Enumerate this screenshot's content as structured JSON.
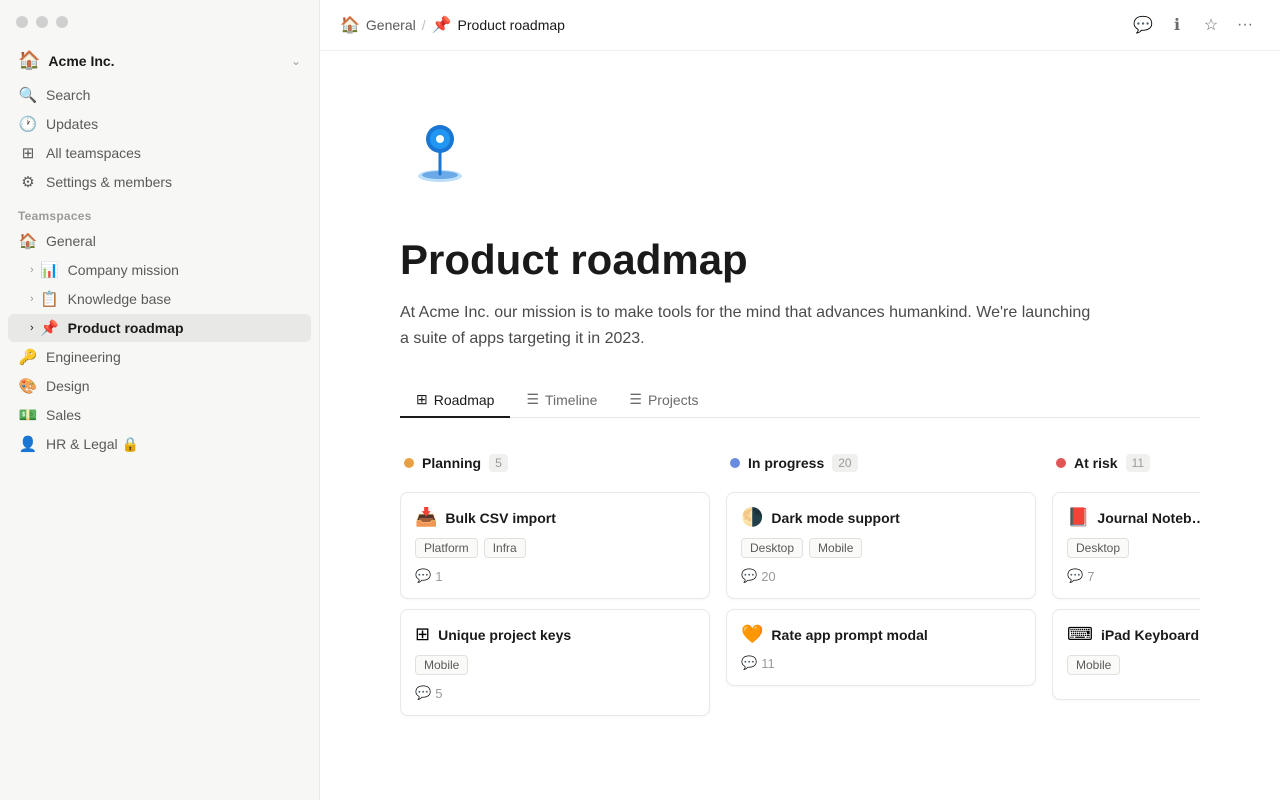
{
  "window": {
    "title": "Product roadmap"
  },
  "sidebar": {
    "workspace_name": "Acme Inc.",
    "workspace_chevron": "⌄",
    "nav_items": [
      {
        "id": "search",
        "icon": "🔍",
        "label": "Search"
      },
      {
        "id": "updates",
        "icon": "🕐",
        "label": "Updates"
      },
      {
        "id": "teamspaces",
        "icon": "⊞",
        "label": "All teamspaces"
      },
      {
        "id": "settings",
        "icon": "⚙",
        "label": "Settings & members"
      }
    ],
    "teamspaces_label": "Teamspaces",
    "teamspaces": [
      {
        "id": "general",
        "icon": "🏠",
        "label": "General",
        "level": 0,
        "has_chevron": false
      },
      {
        "id": "company-mission",
        "icon": "📊",
        "label": "Company mission",
        "level": 1,
        "has_chevron": true,
        "collapsed": true
      },
      {
        "id": "knowledge-base",
        "icon": "📋",
        "label": "Knowledge base",
        "level": 1,
        "has_chevron": true,
        "collapsed": true
      },
      {
        "id": "product-roadmap",
        "icon": "📌",
        "label": "Product roadmap",
        "level": 1,
        "has_chevron": true,
        "active": true
      },
      {
        "id": "engineering",
        "icon": "🔑",
        "label": "Engineering",
        "level": 0,
        "has_chevron": false
      },
      {
        "id": "design",
        "icon": "🎨",
        "label": "Design",
        "level": 0,
        "has_chevron": false
      },
      {
        "id": "sales",
        "icon": "💵",
        "label": "Sales",
        "level": 0,
        "has_chevron": false
      },
      {
        "id": "hr-legal",
        "icon": "👤",
        "label": "HR & Legal 🔒",
        "level": 0,
        "has_chevron": false
      }
    ]
  },
  "topbar": {
    "breadcrumb_home_icon": "🏠",
    "breadcrumb_home": "General",
    "breadcrumb_sep": "/",
    "breadcrumb_page_icon": "📌",
    "breadcrumb_page": "Product roadmap",
    "buttons": [
      "💬",
      "ℹ",
      "☆",
      "···"
    ]
  },
  "page": {
    "emoji": "📌",
    "title": "Product roadmap",
    "description": "At Acme Inc. our mission is to make tools for the mind that advances humankind. We're launching a suite of apps targeting it in 2023."
  },
  "tabs": [
    {
      "id": "roadmap",
      "icon": "⊞",
      "label": "Roadmap",
      "active": true
    },
    {
      "id": "timeline",
      "icon": "☰",
      "label": "Timeline",
      "active": false
    },
    {
      "id": "projects",
      "icon": "☰",
      "label": "Projects",
      "active": false
    }
  ],
  "kanban": {
    "columns": [
      {
        "id": "planning",
        "title": "Planning",
        "count": "5",
        "dot_class": "dot-planning",
        "cards": [
          {
            "id": "bulk-csv",
            "icon": "📥",
            "title": "Bulk CSV import",
            "tags": [
              "Platform",
              "Infra"
            ],
            "comments": "1"
          },
          {
            "id": "unique-keys",
            "icon": "⊞",
            "title": "Unique project keys",
            "tags": [
              "Mobile"
            ],
            "comments": "5"
          }
        ]
      },
      {
        "id": "inprogress",
        "title": "In progress",
        "count": "20",
        "dot_class": "dot-inprogress",
        "cards": [
          {
            "id": "dark-mode",
            "icon": "🌗",
            "title": "Dark mode support",
            "tags": [
              "Desktop",
              "Mobile"
            ],
            "comments": "20"
          },
          {
            "id": "rate-app",
            "icon": "🧡",
            "title": "Rate app prompt modal",
            "tags": [],
            "comments": "11"
          }
        ]
      },
      {
        "id": "atrisk",
        "title": "At risk",
        "count": "11",
        "dot_class": "dot-atrisk",
        "cards": [
          {
            "id": "journal-notebook",
            "icon": "📕",
            "title": "Journal Noteb…",
            "tags": [
              "Desktop"
            ],
            "comments": "7"
          },
          {
            "id": "ipad-keyboard",
            "icon": "⌨",
            "title": "iPad Keyboard…",
            "tags": [
              "Mobile"
            ],
            "comments": ""
          }
        ]
      }
    ]
  }
}
